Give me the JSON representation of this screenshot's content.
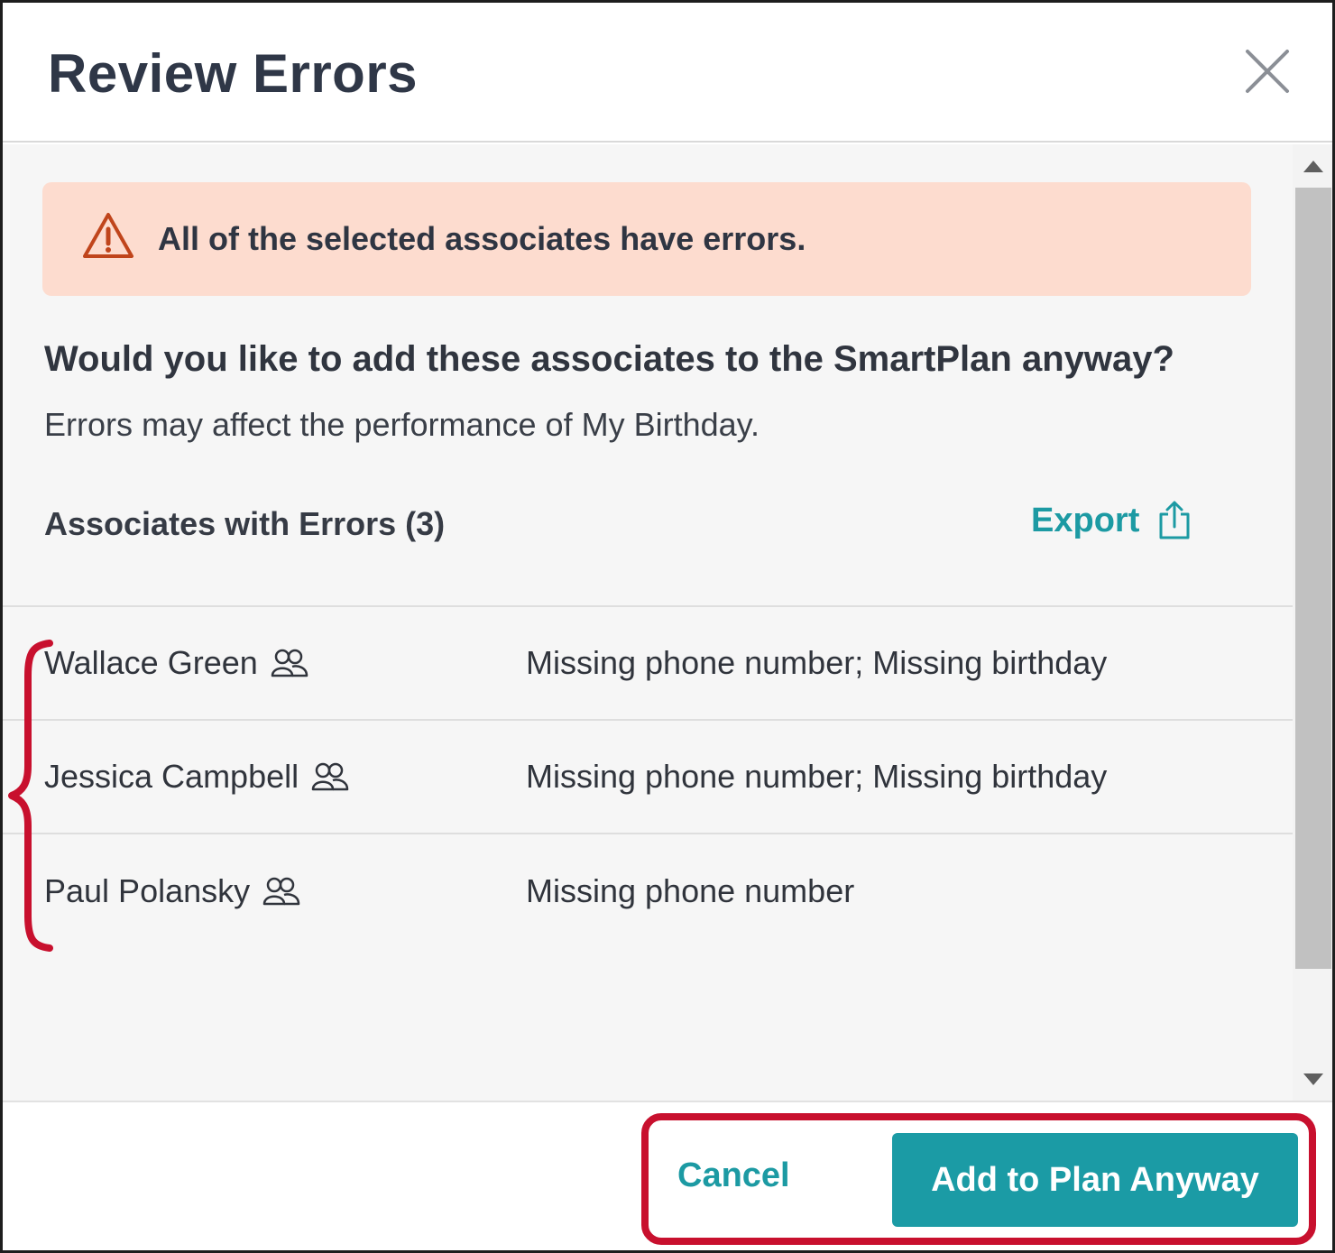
{
  "dialog": {
    "title": "Review Errors",
    "close_icon": "close-icon"
  },
  "alert": {
    "icon": "warning-icon",
    "message": "All of the selected associates have errors."
  },
  "prompt": {
    "question": "Would you like to add these associates to the SmartPlan anyway?",
    "subtext": "Errors may affect the performance of My Birthday."
  },
  "errors_section": {
    "title": "Associates with Errors (3)",
    "export_label": "Export",
    "export_icon": "share-icon"
  },
  "associates": [
    {
      "name": "Wallace Green",
      "icon": "group-icon",
      "error": "Missing phone number; Missing birthday"
    },
    {
      "name": "Jessica Campbell",
      "icon": "group-icon",
      "error": "Missing phone number; Missing birthday"
    },
    {
      "name": "Paul Polansky",
      "icon": "group-icon",
      "error": "Missing phone number"
    }
  ],
  "footer": {
    "cancel_label": "Cancel",
    "confirm_label": "Add to Plan Anyway"
  },
  "colors": {
    "accent": "#1b9ba5",
    "alert_bg": "#fddccf",
    "alert_icon": "#c0451c",
    "annotation": "#c8102e"
  }
}
